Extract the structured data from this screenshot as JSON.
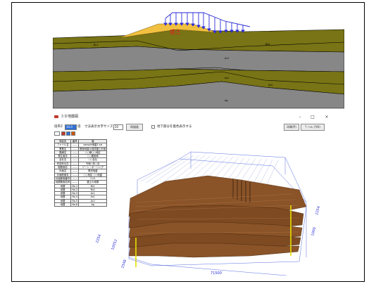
{
  "section": {
    "embankment_label": "盛土",
    "layer_labels": [
      "Bc1",
      "Bs2",
      "Ac1",
      "As1",
      "As2",
      "Ag"
    ],
    "colors": {
      "embankment": "#f2c040",
      "olive": "#797415",
      "gray": "#878787",
      "load": "#2a2ad8",
      "label": "#e02020"
    }
  },
  "window": {
    "title": "３Ｄ地層図",
    "controls": {
      "minimize": "–",
      "maximize": "□",
      "close": "×"
    },
    "toolbar": {
      "magnify_label": "倍率Z",
      "magnify_value": "10.0",
      "magnify_unit": "倍",
      "font_label": "寸法表示文字サイズ",
      "font_value": "20",
      "redraw_button": "再描画",
      "checkbox_label": "地下部分を着色表示する",
      "print_button": "印刷(P)",
      "help_button": "? ヘルプ(H)"
    },
    "table": {
      "headers": [
        "項目名",
        "番号",
        "値"
      ],
      "rows": [
        [
          "ファイル名",
          "------",
          "sample地盤3.xls"
        ],
        [
          "業務名",
          "------",
          "断面地盤の造成盛土計画"
        ],
        [
          "路線名",
          "------",
          "○○線○○地区"
        ],
        [
          "発注者名",
          "------",
          "○○建設局"
        ],
        [
          "会社名",
          "------",
          "○○会社"
        ],
        [
          "作成年月日",
          "------",
          "令和○年○月"
        ],
        [
          "縦断面名",
          "------",
          "ゾーン・ボーリング"
        ],
        [
          "計画名",
          "------",
          "現況地盤"
        ],
        [
          "計画断面名",
          "------",
          "○○地区 ○○地盤"
        ],
        [
          "計画断面番号",
          "------",
          "1.01"
        ],
        [
          "地層断面名称",
          "------",
          "盛土の地層"
        ],
        [
          "地層",
          "No.1",
          "Bs1"
        ],
        [
          "地層",
          "No.2",
          "Bs2"
        ],
        [
          "地層",
          "No.3",
          "Ac1"
        ],
        [
          "地層",
          "No.4",
          "As1"
        ],
        [
          "地層",
          "No.5",
          "Ac2"
        ],
        [
          "地層",
          "No.6",
          "Ag"
        ]
      ]
    },
    "plot": {
      "dim_width": "71500",
      "dim_depth_left": "10052",
      "dim_depth_front": "1548",
      "dim_height": "2254",
      "dim_right_a": "1000",
      "dim_right_b": "2254"
    }
  }
}
